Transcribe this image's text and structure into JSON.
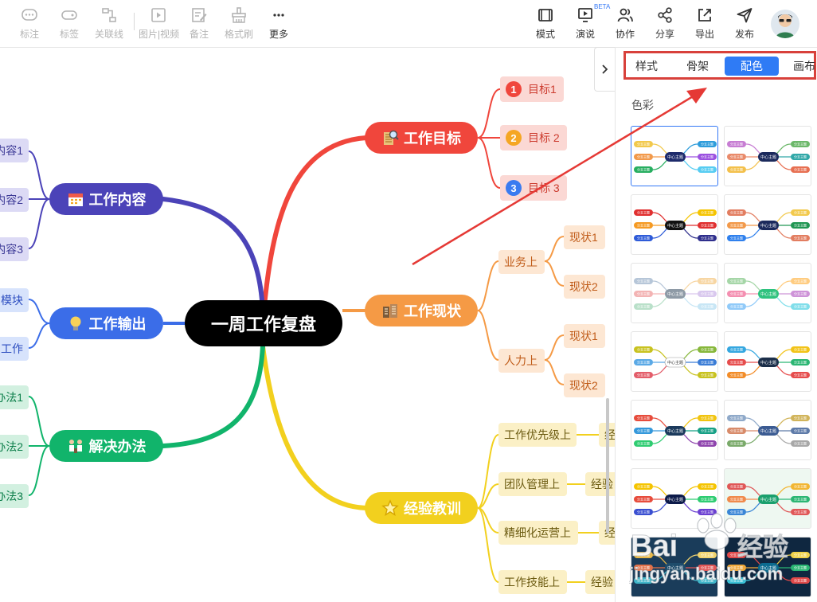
{
  "toolbar": {
    "left": [
      {
        "label": "标注",
        "icon": "comment-icon"
      },
      {
        "label": "标签",
        "icon": "tag-icon"
      },
      {
        "label": "关联线",
        "icon": "relation-line-icon"
      },
      {
        "label": "图片|视频",
        "icon": "image-video-icon"
      },
      {
        "label": "备注",
        "icon": "note-icon"
      },
      {
        "label": "格式刷",
        "icon": "format-brush-icon"
      },
      {
        "label": "更多",
        "icon": "more-icon"
      }
    ],
    "right": [
      {
        "label": "模式",
        "icon": "mode-icon"
      },
      {
        "label": "演说",
        "icon": "presentation-icon",
        "badge": "BETA"
      },
      {
        "label": "协作",
        "icon": "collaborate-icon"
      },
      {
        "label": "分享",
        "icon": "share-icon"
      },
      {
        "label": "导出",
        "icon": "export-icon"
      },
      {
        "label": "发布",
        "icon": "publish-icon"
      }
    ]
  },
  "mindmap": {
    "root": "一周工作复盘",
    "branches": {
      "goal": {
        "label": "工作目标",
        "color": "#f0463c",
        "leaves": [
          "目标1",
          "目标 2",
          "目标 3"
        ],
        "num_colors": [
          "#f0463c",
          "#f5a623",
          "#3a7bf0"
        ]
      },
      "status": {
        "label": "工作现状",
        "color": "#f59a45",
        "sub": [
          "业务上",
          "人力上"
        ],
        "leaves": [
          "现状1",
          "现状2",
          "现状1",
          "现状2"
        ]
      },
      "lessons": {
        "label": "经验教训",
        "color": "#f2d01e",
        "sub": [
          "工作优先级上",
          "团队管理上",
          "精细化运营上",
          "工作技能上"
        ],
        "leaves": [
          "经",
          "经验",
          "经",
          "经验"
        ]
      },
      "content": {
        "label": "工作内容",
        "color": "#4b43b8",
        "leaves": [
          "内容1",
          "内容2",
          "内容3"
        ]
      },
      "output": {
        "label": "工作输出",
        "color": "#3b6de8",
        "leaves": [
          "模块",
          "工作"
        ]
      },
      "solution": {
        "label": "解决办法",
        "color": "#11b46b",
        "leaves": [
          "办法1",
          "办法2",
          "办法3"
        ]
      }
    }
  },
  "panel": {
    "tabs": [
      "样式",
      "骨架",
      "配色",
      "画布"
    ],
    "active_tab": "配色",
    "section": "色彩",
    "theme_center_label": "中心主题",
    "theme_branch_label": "分支主题",
    "themes": [
      {
        "center": "#1d2a6b",
        "bg": "#ffffff",
        "colors": [
          "#f2c94c",
          "#f2994a",
          "#27ae60",
          "#2d9cdb",
          "#9b51e0",
          "#56ccf2"
        ]
      },
      {
        "center": "#1b2a5c",
        "bg": "#ffffff",
        "colors": [
          "#c77dd3",
          "#e98a6a",
          "#f3c04b",
          "#6cb86a",
          "#31a8a8",
          "#e76f51"
        ]
      },
      {
        "center": "#111111",
        "bg": "#ffffff",
        "colors": [
          "#e02f2f",
          "#f59a23",
          "#2e5bd8",
          "#f5c400",
          "#e02f2f",
          "#2e2e8c"
        ]
      },
      {
        "center": "#1b2a5c",
        "bg": "#ffffff",
        "colors": [
          "#e27d60",
          "#f2994a",
          "#2f80ed",
          "#f2c94c",
          "#219653",
          "#e27d60"
        ]
      },
      {
        "center": "#8e9aa6",
        "bg": "#ffffff",
        "colors": [
          "#b6c6d8",
          "#f3b4b4",
          "#b9e0c9",
          "#f7d6a3",
          "#d9c8ee",
          "#c8e6f5"
        ]
      },
      {
        "center": "#2ec27e",
        "bg": "#ffffff",
        "colors": [
          "#a5d6a7",
          "#f48fb1",
          "#90caf9",
          "#ffcc80",
          "#ce93d8",
          "#80deea"
        ]
      },
      {
        "center": "#ffffff",
        "bg": "#ffffff",
        "colors": [
          "#c8c21f",
          "#5aa9e6",
          "#e35d6a",
          "#86b73a",
          "#3a7cd6",
          "#c8c21f"
        ]
      },
      {
        "center": "#1c2f4a",
        "bg": "#ffffff",
        "colors": [
          "#35a7e0",
          "#e64c4c",
          "#f28c28",
          "#f2c318",
          "#2bb673",
          "#e64c4c"
        ]
      },
      {
        "center": "#1b3a5c",
        "bg": "#ffffff",
        "colors": [
          "#e74c3c",
          "#3498db",
          "#2ecc71",
          "#f1c40f",
          "#16a085",
          "#8e44ad"
        ]
      },
      {
        "center": "#3b5b92",
        "bg": "#ffffff",
        "colors": [
          "#8fa9c9",
          "#d88b6a",
          "#7aaa6a",
          "#d1b45a",
          "#5d7aa8",
          "#a8a8a8"
        ]
      },
      {
        "center": "#0d1b4a",
        "bg": "#ffffff",
        "colors": [
          "#f5c400",
          "#e74c3c",
          "#3a4fd1",
          "#f5c400",
          "#2ecc71",
          "#6a3fd1"
        ]
      },
      {
        "center": "#1aa06d",
        "bg": "#eef8f1",
        "colors": [
          "#e05757",
          "#f08a4b",
          "#3a86d6",
          "#f2b632",
          "#2bb673",
          "#e05757"
        ]
      },
      {
        "center": "#1e4c6b",
        "bg": "#1a3c5a",
        "colors": [
          "#e9b949",
          "#e3724a",
          "#3fb6c9",
          "#f2d46f",
          "#e05757",
          "#3fb6c9"
        ]
      },
      {
        "center": "#0b6b8f",
        "bg": "#0f2740",
        "colors": [
          "#e04a4a",
          "#f0a93b",
          "#3ac1d6",
          "#f0d24a",
          "#2bb673",
          "#e04a4a"
        ]
      }
    ]
  },
  "watermark": {
    "brand": "Bai",
    "brand2": "经验",
    "url": "jingyan.baidu.com"
  }
}
